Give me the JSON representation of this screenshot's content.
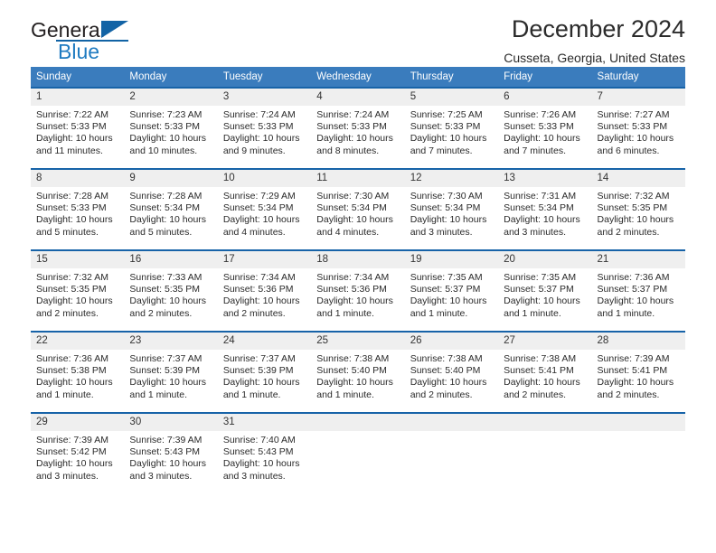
{
  "brand": {
    "name_part1": "General",
    "name_part2": "Blue",
    "logo_icon": "triangle-logo-icon"
  },
  "header": {
    "title": "December 2024",
    "location": "Cusseta, Georgia, United States"
  },
  "colors": {
    "header_blue": "#3a7cbd",
    "row_divider_blue": "#1763a8",
    "daynum_band": "#efefef",
    "brand_blue": "#1f7bc1"
  },
  "day_of_week_headers": [
    "Sunday",
    "Monday",
    "Tuesday",
    "Wednesday",
    "Thursday",
    "Friday",
    "Saturday"
  ],
  "labels": {
    "sunrise_prefix": "Sunrise:",
    "sunset_prefix": "Sunset:",
    "daylight_prefix": "Daylight:"
  },
  "weeks": [
    [
      {
        "day": "1",
        "sunrise": "Sunrise: 7:22 AM",
        "sunset": "Sunset: 5:33 PM",
        "daylight_line1": "Daylight: 10 hours",
        "daylight_line2": "and 11 minutes."
      },
      {
        "day": "2",
        "sunrise": "Sunrise: 7:23 AM",
        "sunset": "Sunset: 5:33 PM",
        "daylight_line1": "Daylight: 10 hours",
        "daylight_line2": "and 10 minutes."
      },
      {
        "day": "3",
        "sunrise": "Sunrise: 7:24 AM",
        "sunset": "Sunset: 5:33 PM",
        "daylight_line1": "Daylight: 10 hours",
        "daylight_line2": "and 9 minutes."
      },
      {
        "day": "4",
        "sunrise": "Sunrise: 7:24 AM",
        "sunset": "Sunset: 5:33 PM",
        "daylight_line1": "Daylight: 10 hours",
        "daylight_line2": "and 8 minutes."
      },
      {
        "day": "5",
        "sunrise": "Sunrise: 7:25 AM",
        "sunset": "Sunset: 5:33 PM",
        "daylight_line1": "Daylight: 10 hours",
        "daylight_line2": "and 7 minutes."
      },
      {
        "day": "6",
        "sunrise": "Sunrise: 7:26 AM",
        "sunset": "Sunset: 5:33 PM",
        "daylight_line1": "Daylight: 10 hours",
        "daylight_line2": "and 7 minutes."
      },
      {
        "day": "7",
        "sunrise": "Sunrise: 7:27 AM",
        "sunset": "Sunset: 5:33 PM",
        "daylight_line1": "Daylight: 10 hours",
        "daylight_line2": "and 6 minutes."
      }
    ],
    [
      {
        "day": "8",
        "sunrise": "Sunrise: 7:28 AM",
        "sunset": "Sunset: 5:33 PM",
        "daylight_line1": "Daylight: 10 hours",
        "daylight_line2": "and 5 minutes."
      },
      {
        "day": "9",
        "sunrise": "Sunrise: 7:28 AM",
        "sunset": "Sunset: 5:34 PM",
        "daylight_line1": "Daylight: 10 hours",
        "daylight_line2": "and 5 minutes."
      },
      {
        "day": "10",
        "sunrise": "Sunrise: 7:29 AM",
        "sunset": "Sunset: 5:34 PM",
        "daylight_line1": "Daylight: 10 hours",
        "daylight_line2": "and 4 minutes."
      },
      {
        "day": "11",
        "sunrise": "Sunrise: 7:30 AM",
        "sunset": "Sunset: 5:34 PM",
        "daylight_line1": "Daylight: 10 hours",
        "daylight_line2": "and 4 minutes."
      },
      {
        "day": "12",
        "sunrise": "Sunrise: 7:30 AM",
        "sunset": "Sunset: 5:34 PM",
        "daylight_line1": "Daylight: 10 hours",
        "daylight_line2": "and 3 minutes."
      },
      {
        "day": "13",
        "sunrise": "Sunrise: 7:31 AM",
        "sunset": "Sunset: 5:34 PM",
        "daylight_line1": "Daylight: 10 hours",
        "daylight_line2": "and 3 minutes."
      },
      {
        "day": "14",
        "sunrise": "Sunrise: 7:32 AM",
        "sunset": "Sunset: 5:35 PM",
        "daylight_line1": "Daylight: 10 hours",
        "daylight_line2": "and 2 minutes."
      }
    ],
    [
      {
        "day": "15",
        "sunrise": "Sunrise: 7:32 AM",
        "sunset": "Sunset: 5:35 PM",
        "daylight_line1": "Daylight: 10 hours",
        "daylight_line2": "and 2 minutes."
      },
      {
        "day": "16",
        "sunrise": "Sunrise: 7:33 AM",
        "sunset": "Sunset: 5:35 PM",
        "daylight_line1": "Daylight: 10 hours",
        "daylight_line2": "and 2 minutes."
      },
      {
        "day": "17",
        "sunrise": "Sunrise: 7:34 AM",
        "sunset": "Sunset: 5:36 PM",
        "daylight_line1": "Daylight: 10 hours",
        "daylight_line2": "and 2 minutes."
      },
      {
        "day": "18",
        "sunrise": "Sunrise: 7:34 AM",
        "sunset": "Sunset: 5:36 PM",
        "daylight_line1": "Daylight: 10 hours",
        "daylight_line2": "and 1 minute."
      },
      {
        "day": "19",
        "sunrise": "Sunrise: 7:35 AM",
        "sunset": "Sunset: 5:37 PM",
        "daylight_line1": "Daylight: 10 hours",
        "daylight_line2": "and 1 minute."
      },
      {
        "day": "20",
        "sunrise": "Sunrise: 7:35 AM",
        "sunset": "Sunset: 5:37 PM",
        "daylight_line1": "Daylight: 10 hours",
        "daylight_line2": "and 1 minute."
      },
      {
        "day": "21",
        "sunrise": "Sunrise: 7:36 AM",
        "sunset": "Sunset: 5:37 PM",
        "daylight_line1": "Daylight: 10 hours",
        "daylight_line2": "and 1 minute."
      }
    ],
    [
      {
        "day": "22",
        "sunrise": "Sunrise: 7:36 AM",
        "sunset": "Sunset: 5:38 PM",
        "daylight_line1": "Daylight: 10 hours",
        "daylight_line2": "and 1 minute."
      },
      {
        "day": "23",
        "sunrise": "Sunrise: 7:37 AM",
        "sunset": "Sunset: 5:39 PM",
        "daylight_line1": "Daylight: 10 hours",
        "daylight_line2": "and 1 minute."
      },
      {
        "day": "24",
        "sunrise": "Sunrise: 7:37 AM",
        "sunset": "Sunset: 5:39 PM",
        "daylight_line1": "Daylight: 10 hours",
        "daylight_line2": "and 1 minute."
      },
      {
        "day": "25",
        "sunrise": "Sunrise: 7:38 AM",
        "sunset": "Sunset: 5:40 PM",
        "daylight_line1": "Daylight: 10 hours",
        "daylight_line2": "and 1 minute."
      },
      {
        "day": "26",
        "sunrise": "Sunrise: 7:38 AM",
        "sunset": "Sunset: 5:40 PM",
        "daylight_line1": "Daylight: 10 hours",
        "daylight_line2": "and 2 minutes."
      },
      {
        "day": "27",
        "sunrise": "Sunrise: 7:38 AM",
        "sunset": "Sunset: 5:41 PM",
        "daylight_line1": "Daylight: 10 hours",
        "daylight_line2": "and 2 minutes."
      },
      {
        "day": "28",
        "sunrise": "Sunrise: 7:39 AM",
        "sunset": "Sunset: 5:41 PM",
        "daylight_line1": "Daylight: 10 hours",
        "daylight_line2": "and 2 minutes."
      }
    ],
    [
      {
        "day": "29",
        "sunrise": "Sunrise: 7:39 AM",
        "sunset": "Sunset: 5:42 PM",
        "daylight_line1": "Daylight: 10 hours",
        "daylight_line2": "and 3 minutes."
      },
      {
        "day": "30",
        "sunrise": "Sunrise: 7:39 AM",
        "sunset": "Sunset: 5:43 PM",
        "daylight_line1": "Daylight: 10 hours",
        "daylight_line2": "and 3 minutes."
      },
      {
        "day": "31",
        "sunrise": "Sunrise: 7:40 AM",
        "sunset": "Sunset: 5:43 PM",
        "daylight_line1": "Daylight: 10 hours",
        "daylight_line2": "and 3 minutes."
      },
      {
        "day": "",
        "sunrise": "",
        "sunset": "",
        "daylight_line1": "",
        "daylight_line2": ""
      },
      {
        "day": "",
        "sunrise": "",
        "sunset": "",
        "daylight_line1": "",
        "daylight_line2": ""
      },
      {
        "day": "",
        "sunrise": "",
        "sunset": "",
        "daylight_line1": "",
        "daylight_line2": ""
      },
      {
        "day": "",
        "sunrise": "",
        "sunset": "",
        "daylight_line1": "",
        "daylight_line2": ""
      }
    ]
  ]
}
